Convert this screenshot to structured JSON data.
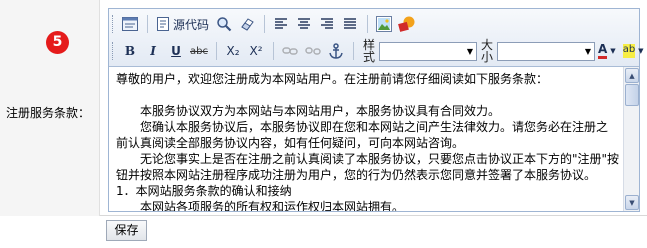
{
  "step_badge": "5",
  "field_label": "注册服务条款：",
  "toolbar": {
    "row1": [
      {
        "name": "source-view-icon",
        "label": ""
      },
      {
        "name": "source-code-button",
        "label": "源代码"
      },
      {
        "name": "zoom-icon",
        "label": ""
      },
      {
        "name": "eraser-icon",
        "label": ""
      },
      {
        "name": "align-left-icon",
        "label": ""
      },
      {
        "name": "align-center-icon",
        "label": ""
      },
      {
        "name": "align-right-icon",
        "label": ""
      },
      {
        "name": "align-justify-icon",
        "label": ""
      },
      {
        "name": "image-icon",
        "label": ""
      },
      {
        "name": "flash-icon",
        "label": ""
      }
    ],
    "row2": {
      "bold": "B",
      "italic": "I",
      "underline": "U",
      "strike": "abc",
      "subscript": "X₂",
      "superscript": "X²",
      "style_label": "样式",
      "style_value": "",
      "size_label": "大小",
      "size_value": "",
      "font_color": "A",
      "highlight": "ab"
    }
  },
  "content": {
    "lines": [
      {
        "text": "尊敬的用户，欢迎您注册成为本网站用户。在注册前请您仔细阅读如下服务条款：",
        "indent": false
      },
      {
        "text": "",
        "indent": false
      },
      {
        "text": "本服务协议双方为本网站与本网站用户，本服务协议具有合同效力。",
        "indent": true
      },
      {
        "text": "您确认本服务协议后，本服务协议即在您和本网站之间产生法律效力。请您务必在注册之",
        "indent": true
      },
      {
        "text": "前认真阅读全部服务协议内容，如有任何疑问，可向本网站咨询。",
        "indent": false
      },
      {
        "text": "无论您事实上是否在注册之前认真阅读了本服务协议，只要您点击协议正本下方的\"注册\"按",
        "indent": true
      },
      {
        "text": "钮并按照本网站注册程序成功注册为用户，您的行为仍然表示您同意并签署了本服务协议。",
        "indent": false
      },
      {
        "text": "1．本网站服务条款的确认和接纳",
        "indent": false
      },
      {
        "text": "本网站各项服务的所有权和运作权归本网站拥有。",
        "indent": true
      }
    ]
  },
  "save_label": "保存"
}
